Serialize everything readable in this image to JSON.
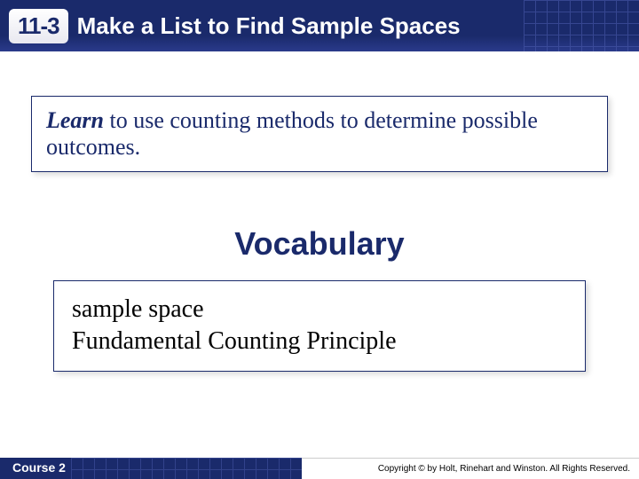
{
  "header": {
    "lesson_number": "11-3",
    "title": "Make a List to Find Sample Spaces"
  },
  "learn": {
    "label": "Learn",
    "text": " to use counting methods to determine possible outcomes."
  },
  "vocabulary": {
    "heading": "Vocabulary",
    "items": [
      "sample space",
      "Fundamental Counting Principle"
    ]
  },
  "footer": {
    "course": "Course 2",
    "copyright": "Copyright © by Holt, Rinehart and Winston. All Rights Reserved."
  }
}
